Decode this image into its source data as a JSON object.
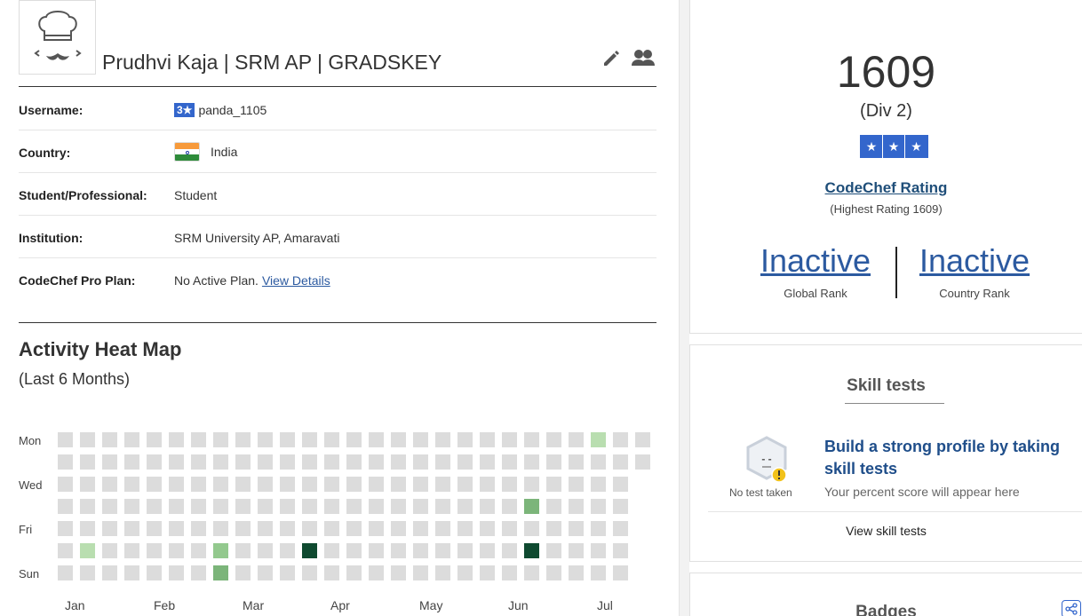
{
  "profile": {
    "name": "Prudhvi Kaja | SRM AP | GRADSKEY"
  },
  "info": {
    "username": {
      "label": "Username:",
      "badge": "3★",
      "value": "panda_1105"
    },
    "country": {
      "label": "Country:",
      "value": "India"
    },
    "student_professional": {
      "label": "Student/Professional:",
      "value": "Student"
    },
    "institution": {
      "label": "Institution:",
      "value": "SRM University AP, Amaravati"
    },
    "pro_plan": {
      "label": "CodeChef Pro Plan:",
      "value": "No Active Plan.",
      "link": "View Details"
    }
  },
  "heatmap": {
    "title": "Activity Heat Map",
    "subtitle": "(Last 6 Months)",
    "day_labels": [
      "Mon",
      "Wed",
      "Fri",
      "Sun"
    ],
    "month_labels": [
      "Jan",
      "Feb",
      "Mar",
      "Apr",
      "May",
      "Jun",
      "Jul"
    ],
    "colors": {
      "empty": "#dcdcdc",
      "level1": "#b9deb0",
      "level2": "#93c98e",
      "level3": "#7cb57a",
      "level4": "#0f4a30"
    },
    "active_cells": [
      {
        "week": 24,
        "day": 0,
        "level": 1
      },
      {
        "week": 21,
        "day": 3,
        "level": 3
      },
      {
        "week": 1,
        "day": 5,
        "level": 1
      },
      {
        "week": 7,
        "day": 5,
        "level": 2
      },
      {
        "week": 11,
        "day": 5,
        "level": 4
      },
      {
        "week": 21,
        "day": 5,
        "level": 4
      },
      {
        "week": 7,
        "day": 6,
        "level": 3
      }
    ]
  },
  "rating": {
    "value": "1609",
    "division": "(Div 2)",
    "stars": [
      "★",
      "★",
      "★"
    ],
    "link": "CodeChef Rating",
    "highest": "(Highest Rating 1609)",
    "global_rank": "Inactive",
    "global_rank_label": "Global Rank",
    "country_rank": "Inactive",
    "country_rank_label": "Country Rank"
  },
  "skill_tests": {
    "title": "Skill tests",
    "no_test": "No test taken",
    "headline": "Build a strong profile by taking skill tests",
    "sub": "Your percent score will appear here",
    "view": "View skill tests"
  },
  "badges": {
    "title": "Badges"
  },
  "theme": {
    "accent": "#3366cc",
    "link": "#2c5aa0",
    "dark_link": "#1f4e79"
  }
}
